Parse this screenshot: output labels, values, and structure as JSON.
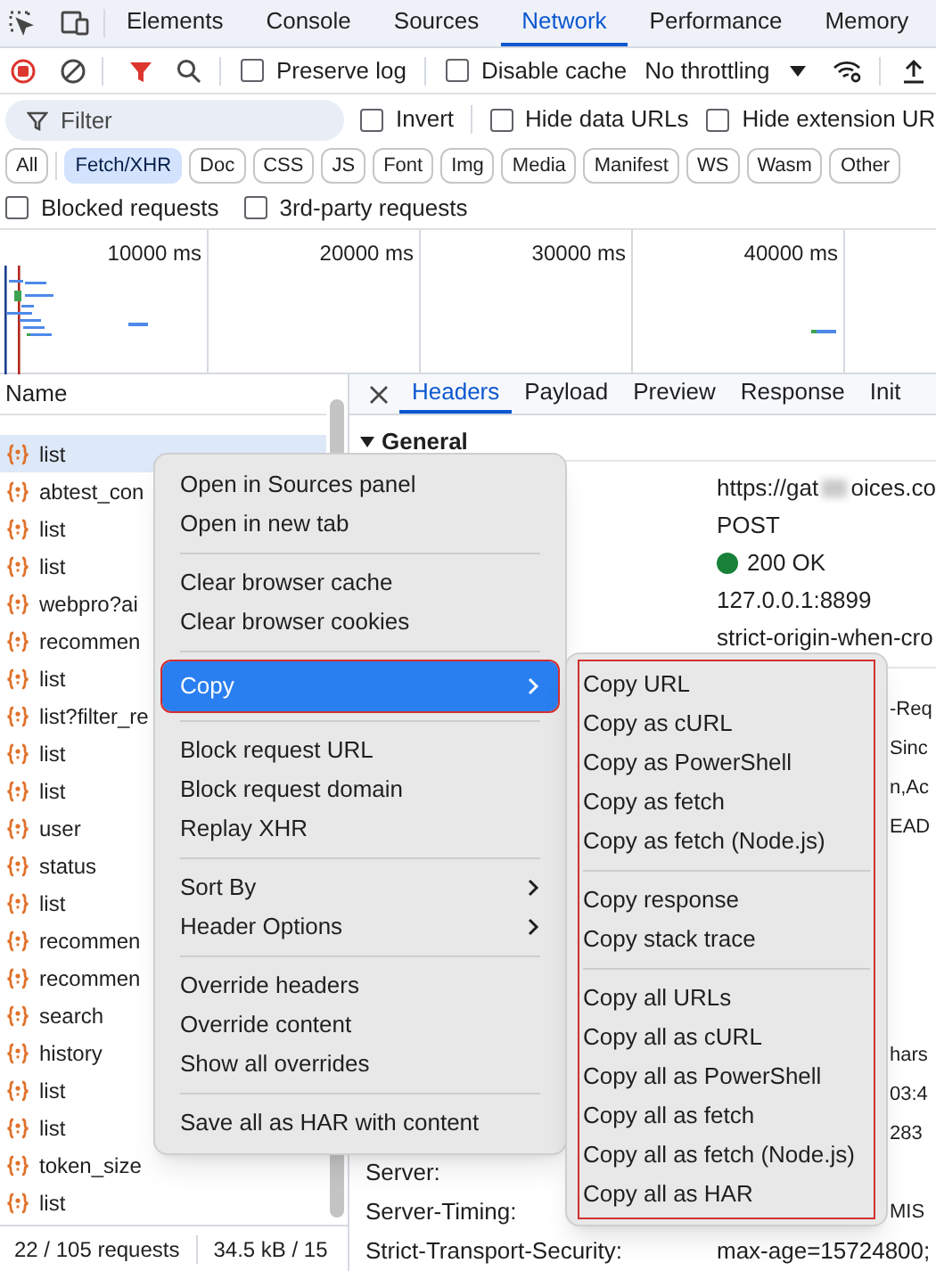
{
  "panel_tabs": [
    {
      "label": "Elements",
      "selected": false
    },
    {
      "label": "Console",
      "selected": false
    },
    {
      "label": "Sources",
      "selected": false
    },
    {
      "label": "Network",
      "selected": true
    },
    {
      "label": "Performance",
      "selected": false
    },
    {
      "label": "Memory",
      "selected": false
    }
  ],
  "network_toolbar": {
    "options": [
      {
        "label": "Preserve log",
        "checked": false
      },
      {
        "label": "Disable cache",
        "checked": false
      }
    ],
    "throttling": "No throttling"
  },
  "filter": {
    "placeholder": "Filter",
    "options": [
      {
        "label": "Invert",
        "checked": false
      },
      {
        "label": "Hide data URLs",
        "checked": false
      },
      {
        "label": "Hide extension UR",
        "checked": false
      }
    ]
  },
  "type_filters": [
    {
      "label": "All",
      "selected": false
    },
    {
      "label": "Fetch/XHR",
      "selected": true
    },
    {
      "label": "Doc",
      "selected": false
    },
    {
      "label": "CSS",
      "selected": false
    },
    {
      "label": "JS",
      "selected": false
    },
    {
      "label": "Font",
      "selected": false
    },
    {
      "label": "Img",
      "selected": false
    },
    {
      "label": "Media",
      "selected": false
    },
    {
      "label": "Manifest",
      "selected": false
    },
    {
      "label": "WS",
      "selected": false
    },
    {
      "label": "Wasm",
      "selected": false
    },
    {
      "label": "Other",
      "selected": false
    }
  ],
  "extra_filters": [
    {
      "label": "Blocked requests",
      "checked": false
    },
    {
      "label": "3rd-party requests",
      "checked": false
    }
  ],
  "overview": {
    "ticks": [
      "10000 ms",
      "20000 ms",
      "30000 ms",
      "40000 ms"
    ]
  },
  "requests": {
    "column": "Name",
    "rows": [
      {
        "name": "list",
        "selected": true
      },
      {
        "name": "abtest_con",
        "selected": false
      },
      {
        "name": "list",
        "selected": false
      },
      {
        "name": "list",
        "selected": false
      },
      {
        "name": "webpro?ai",
        "selected": false
      },
      {
        "name": "recommen",
        "selected": false
      },
      {
        "name": "list",
        "selected": false
      },
      {
        "name": "list?filter_re",
        "selected": false
      },
      {
        "name": "list",
        "selected": false
      },
      {
        "name": "list",
        "selected": false
      },
      {
        "name": "user",
        "selected": false
      },
      {
        "name": "status",
        "selected": false
      },
      {
        "name": "list",
        "selected": false
      },
      {
        "name": "recommen",
        "selected": false
      },
      {
        "name": "recommen",
        "selected": false
      },
      {
        "name": "search",
        "selected": false
      },
      {
        "name": "history",
        "selected": false
      },
      {
        "name": "list",
        "selected": false
      },
      {
        "name": "list",
        "selected": false
      },
      {
        "name": "token_size",
        "selected": false
      },
      {
        "name": "list",
        "selected": false
      }
    ]
  },
  "status_bar": {
    "requests": "22 / 105 requests",
    "transferred": "34.5 kB / 15"
  },
  "details": {
    "tabs": [
      {
        "label": "Headers",
        "selected": true
      },
      {
        "label": "Payload",
        "selected": false
      },
      {
        "label": "Preview",
        "selected": false
      },
      {
        "label": "Response",
        "selected": false
      },
      {
        "label": "Init",
        "selected": false
      }
    ],
    "section": "General",
    "general_values": [
      {
        "kind": "url",
        "value": "https://gat",
        "tail": "oices.co"
      },
      {
        "kind": "text",
        "value": "POST"
      },
      {
        "kind": "status",
        "value": "200 OK"
      },
      {
        "kind": "text",
        "value": "127.0.0.1:8899"
      },
      {
        "kind": "text",
        "value": "strict-origin-when-cro"
      }
    ],
    "headers_upper": [
      {
        "value_tail": "-Req"
      },
      {
        "value_tail": "Sinc"
      },
      {
        "value_tail": "n,Ac"
      },
      {
        "value_tail": "EAD"
      }
    ],
    "headers_lower": [
      {
        "value_tail": "hars"
      },
      {
        "value_tail": "03:4"
      },
      {
        "value_tail": "283"
      },
      {
        "name": "Server:"
      },
      {
        "name": "Server-Timing:",
        "value_tail": "MIS"
      },
      {
        "name": "Strict-Transport-Security:",
        "value": "max-age=15724800;"
      }
    ]
  },
  "context_menu": {
    "groups": [
      {
        "items": [
          {
            "label": "Open in Sources panel",
            "has_submenu": false,
            "highlighted": false,
            "outlined": false
          },
          {
            "label": "Open in new tab",
            "has_submenu": false,
            "highlighted": false,
            "outlined": false
          }
        ]
      },
      {
        "items": [
          {
            "label": "Clear browser cache",
            "has_submenu": false,
            "highlighted": false,
            "outlined": false
          },
          {
            "label": "Clear browser cookies",
            "has_submenu": false,
            "highlighted": false,
            "outlined": false
          }
        ]
      },
      {
        "items": [
          {
            "label": "Copy",
            "has_submenu": true,
            "highlighted": true,
            "outlined": true
          }
        ]
      },
      {
        "items": [
          {
            "label": "Block request URL",
            "has_submenu": false,
            "highlighted": false,
            "outlined": false
          },
          {
            "label": "Block request domain",
            "has_submenu": false,
            "highlighted": false,
            "outlined": false
          },
          {
            "label": "Replay XHR",
            "has_submenu": false,
            "highlighted": false,
            "outlined": false
          }
        ]
      },
      {
        "items": [
          {
            "label": "Sort By",
            "has_submenu": true,
            "highlighted": false,
            "outlined": false
          },
          {
            "label": "Header Options",
            "has_submenu": true,
            "highlighted": false,
            "outlined": false
          }
        ]
      },
      {
        "items": [
          {
            "label": "Override headers",
            "has_submenu": false,
            "highlighted": false,
            "outlined": false
          },
          {
            "label": "Override content",
            "has_submenu": false,
            "highlighted": false,
            "outlined": false
          },
          {
            "label": "Show all overrides",
            "has_submenu": false,
            "highlighted": false,
            "outlined": false
          }
        ]
      },
      {
        "items": [
          {
            "label": "Save all as HAR with content",
            "has_submenu": false,
            "highlighted": false,
            "outlined": false
          }
        ]
      }
    ]
  },
  "copy_submenu": {
    "outlined": true,
    "groups": [
      {
        "items": [
          "Copy URL",
          "Copy as cURL",
          "Copy as PowerShell",
          "Copy as fetch",
          "Copy as fetch (Node.js)"
        ]
      },
      {
        "items": [
          "Copy response",
          "Copy stack trace"
        ]
      },
      {
        "items": [
          "Copy all URLs",
          "Copy all as cURL",
          "Copy all as PowerShell",
          "Copy all as fetch",
          "Copy all as fetch (Node.js)",
          "Copy all as HAR"
        ]
      }
    ]
  }
}
